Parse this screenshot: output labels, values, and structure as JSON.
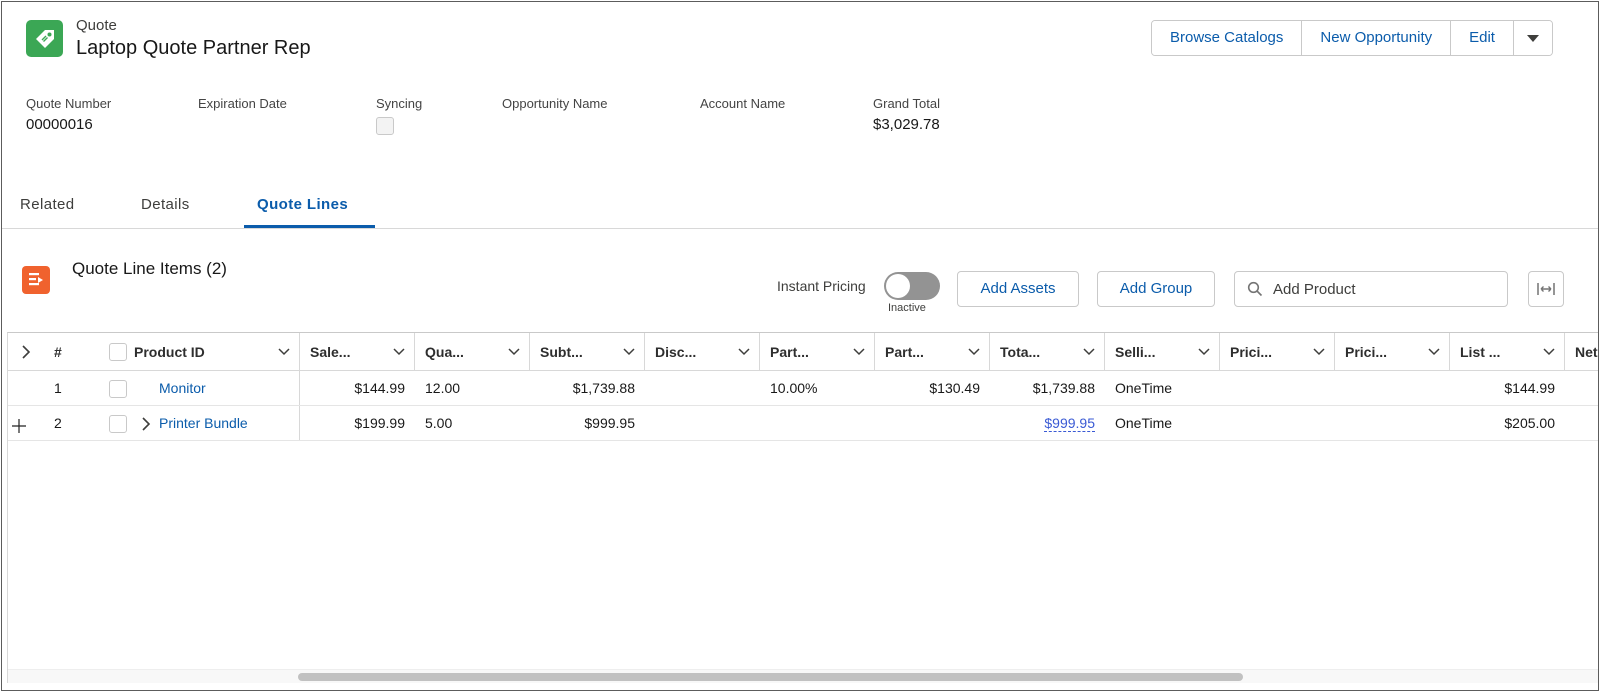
{
  "record": {
    "type": "Quote",
    "title": "Laptop Quote Partner Rep",
    "icon": "price-tag-icon",
    "icon_color": "#3ba755"
  },
  "actions": {
    "browse_catalogs": "Browse Catalogs",
    "new_opportunity": "New Opportunity",
    "edit": "Edit"
  },
  "highlights": {
    "quote_number_label": "Quote Number",
    "quote_number": "00000016",
    "expiration_date_label": "Expiration Date",
    "syncing_label": "Syncing",
    "opportunity_name_label": "Opportunity Name",
    "account_name_label": "Account Name",
    "grand_total_label": "Grand Total",
    "grand_total": "$3,029.78"
  },
  "tabs": [
    "Related",
    "Details",
    "Quote Lines"
  ],
  "active_tab": "Quote Lines",
  "section": {
    "title": "Quote Line Items (2)",
    "icon_color": "#f0622e",
    "instant_pricing_label": "Instant Pricing",
    "instant_pricing_state": "Inactive",
    "add_assets": "Add Assets",
    "add_group": "Add Group",
    "search_placeholder": "Add Product"
  },
  "grid": {
    "headers": [
      "#",
      "Product ID",
      "Sale...",
      "Qua...",
      "Subt...",
      "Disc...",
      "Part...",
      "Part...",
      "Tota...",
      "Selli...",
      "Prici...",
      "Prici...",
      "List ...",
      "Net"
    ],
    "rows": [
      {
        "num": "1",
        "product": "Monitor",
        "expandable": false,
        "sales_price": "$144.99",
        "quantity": "12.00",
        "subtotal": "$1,739.88",
        "discount": "",
        "partner_discount": "10.00%",
        "partner_price": "$130.49",
        "total": "$1,739.88",
        "selling_model": "OneTime",
        "list_price": "$144.99"
      },
      {
        "num": "2",
        "product": "Printer Bundle",
        "expandable": true,
        "sales_price": "$199.99",
        "quantity": "5.00",
        "subtotal": "$999.95",
        "discount": "",
        "partner_discount": "",
        "partner_price": "",
        "total": "$999.95",
        "selling_model": "OneTime",
        "list_price": "$205.00"
      }
    ]
  },
  "colors": {
    "brand_blue": "#0b5cab",
    "border": "#c9c9c9"
  }
}
